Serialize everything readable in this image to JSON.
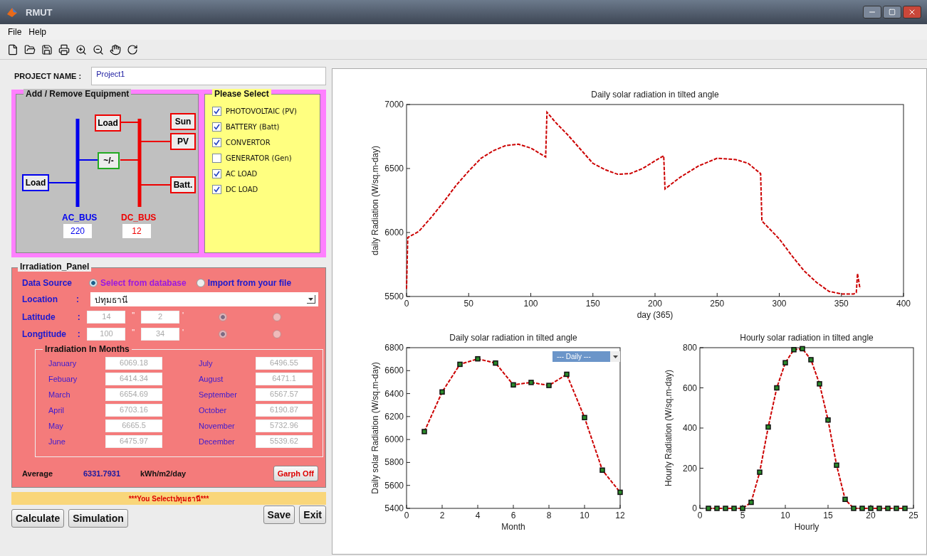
{
  "window": {
    "title": "RMUT"
  },
  "menu": [
    "File",
    "Help"
  ],
  "project": {
    "label": "PROJECT NAME :",
    "value": "Project1"
  },
  "equipment": {
    "title": "Add / Remove Equipment",
    "nodes": [
      {
        "kind": "ac",
        "label": "Load"
      },
      {
        "kind": "dc",
        "label": "Load"
      },
      {
        "kind": "converter",
        "label": "~/-"
      },
      {
        "kind": "dc",
        "label": "Sun"
      },
      {
        "kind": "dc",
        "label": "PV"
      },
      {
        "kind": "dc",
        "label": "Batt."
      }
    ],
    "buses": [
      {
        "kind": "ac",
        "label": "AC_BUS",
        "value": "220"
      },
      {
        "kind": "dc",
        "label": "DC_BUS",
        "value": "12"
      }
    ]
  },
  "select": {
    "title": "Please Select",
    "options": [
      {
        "label": "PHOTOVOLTAIC (PV)",
        "checked": true
      },
      {
        "label": "BATTERY (Batt)",
        "checked": true
      },
      {
        "label": "CONVERTOR",
        "checked": true
      },
      {
        "label": "GENERATOR (Gen)",
        "checked": false
      },
      {
        "label": "AC LOAD",
        "checked": true
      },
      {
        "label": "DC LOAD",
        "checked": true
      }
    ]
  },
  "irradiation": {
    "title": "Irradiation_Panel",
    "data_source": {
      "label": "Data Source",
      "options": [
        {
          "label": "Select from database",
          "selected": true
        },
        {
          "label": "Import from your file",
          "selected": false
        }
      ]
    },
    "location": {
      "label": "Location",
      "colon": ":",
      "value": "ปทุมธานี"
    },
    "coordinates": [
      {
        "label": "Latitude",
        "colon": ":",
        "degrees": "14",
        "deg_mark": "\"",
        "minutes": "2",
        "min_mark": "'",
        "options": [
          {
            "selected": true
          },
          {
            "selected": false
          }
        ]
      },
      {
        "label": "Longtitude",
        "colon": ":",
        "degrees": "100",
        "deg_mark": "\"",
        "minutes": "34",
        "min_mark": "'",
        "options": [
          {
            "selected": true
          },
          {
            "selected": false
          }
        ]
      }
    ],
    "months_title": "Irradiation In Months",
    "months": [
      {
        "name": "January",
        "value": "6069.18"
      },
      {
        "name": "Febuary",
        "value": "6414.34"
      },
      {
        "name": "March",
        "value": "6654.69"
      },
      {
        "name": "April",
        "value": "6703.16"
      },
      {
        "name": "May",
        "value": "6665.5"
      },
      {
        "name": "June",
        "value": "6475.97"
      },
      {
        "name": "July",
        "value": "6496.55"
      },
      {
        "name": "August",
        "value": "6471.1"
      },
      {
        "name": "September",
        "value": "6567.57"
      },
      {
        "name": "October",
        "value": "6190.87"
      },
      {
        "name": "November",
        "value": "5732.96"
      },
      {
        "name": "December",
        "value": "5539.62"
      }
    ],
    "average": {
      "label": "Average",
      "value": "6331.7931",
      "unit": "kWh/m2/day"
    },
    "graph_button": "Garph Off"
  },
  "status": "***You Selectปทุมธานี***",
  "buttons_left": [
    "Calculate",
    "Simulation"
  ],
  "buttons_right": [
    "Save",
    "Exit"
  ],
  "charts": {
    "daily": {
      "chart_data": {
        "type": "line",
        "title": "Daily solar radiation in tilted angle",
        "xlabel": "day (365)",
        "ylabel": "daily Radiation (W/sq.m-day)",
        "xlim": [
          0,
          400
        ],
        "ylim": [
          5500,
          7000
        ],
        "xticks": [
          0,
          50,
          100,
          150,
          200,
          250,
          300,
          350,
          400
        ],
        "yticks": [
          5500,
          6000,
          6500,
          7000
        ],
        "x": [
          0,
          1,
          10,
          20,
          30,
          40,
          50,
          60,
          70,
          80,
          90,
          100,
          112,
          113,
          120,
          130,
          140,
          150,
          160,
          170,
          180,
          190,
          200,
          207,
          208,
          220,
          235,
          250,
          265,
          275,
          285,
          286,
          300,
          310,
          320,
          330,
          340,
          350,
          360,
          362,
          363,
          365
        ],
        "series": [
          {
            "color": "#cc0000",
            "line_style": "dashed",
            "values": [
              5560,
              5960,
              6010,
              6120,
              6240,
              6370,
              6480,
              6580,
              6640,
              6680,
              6690,
              6660,
              6590,
              6940,
              6860,
              6760,
              6650,
              6540,
              6490,
              6455,
              6460,
              6500,
              6560,
              6600,
              6340,
              6430,
              6520,
              6580,
              6570,
              6540,
              6460,
              6090,
              5950,
              5820,
              5700,
              5610,
              5540,
              5520,
              5520,
              5530,
              5680,
              5560
            ]
          }
        ]
      }
    },
    "monthly": {
      "dropdown": "--- Daily ---",
      "chart_data": {
        "type": "line",
        "title": "Daily solar radiation in tilted angle",
        "xlabel": "Month",
        "ylabel": "Daily solar Radiation (W/sq.m-day)",
        "xlim": [
          0,
          12
        ],
        "ylim": [
          5400,
          6800
        ],
        "xticks": [
          0,
          2,
          4,
          6,
          8,
          10,
          12
        ],
        "yticks": [
          5400,
          5600,
          5800,
          6000,
          6200,
          6400,
          6600,
          6800
        ],
        "x": [
          1,
          2,
          3,
          4,
          5,
          6,
          7,
          8,
          9,
          10,
          11,
          12
        ],
        "series": [
          {
            "color": "#cc0000",
            "line_style": "dashed",
            "marker": "square",
            "values": [
              6069,
              6414,
              6655,
              6703,
              6666,
              6476,
              6497,
              6471,
              6568,
              6191,
              5733,
              5540
            ]
          }
        ]
      }
    },
    "hourly": {
      "chart_data": {
        "type": "line",
        "title": "Hourly solar radiation in tilted angle",
        "xlabel": "Hourly",
        "ylabel": "Hourly Radiation (W/sq.m-day)",
        "xlim": [
          0,
          25
        ],
        "ylim": [
          0,
          800
        ],
        "xticks": [
          0,
          5,
          10,
          15,
          20,
          25
        ],
        "yticks": [
          0,
          200,
          400,
          600,
          800
        ],
        "x": [
          1,
          2,
          3,
          4,
          5,
          6,
          7,
          8,
          9,
          10,
          11,
          12,
          13,
          14,
          15,
          16,
          17,
          18,
          19,
          20,
          21,
          22,
          23,
          24
        ],
        "series": [
          {
            "color": "#cc0000",
            "line_style": "dashed",
            "marker": "square",
            "values": [
              0,
              0,
              0,
              0,
              0,
              30,
              180,
              405,
              600,
              725,
              790,
              795,
              740,
              620,
              440,
              215,
              45,
              0,
              0,
              0,
              0,
              0,
              0,
              0
            ]
          }
        ]
      }
    }
  }
}
